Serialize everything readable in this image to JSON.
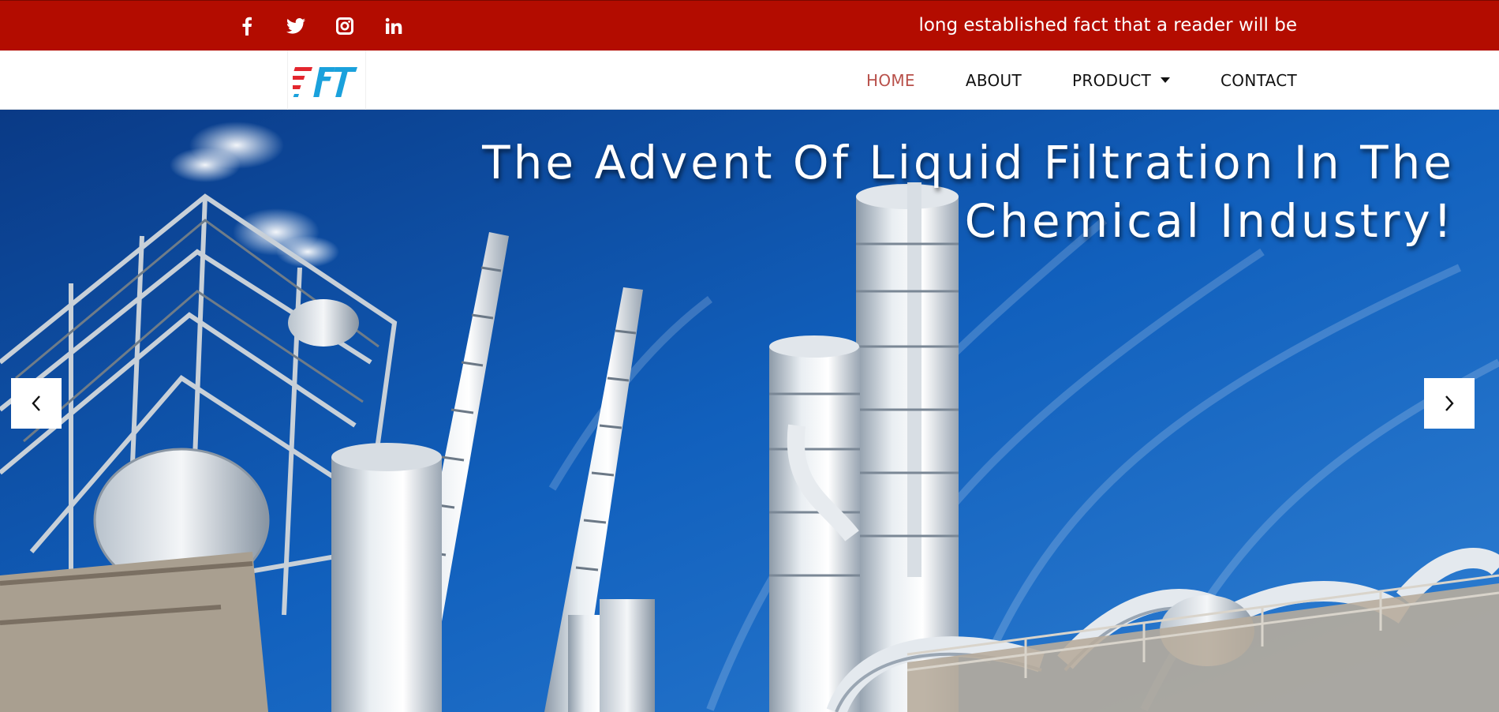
{
  "topbar": {
    "social": [
      {
        "name": "facebook-icon"
      },
      {
        "name": "twitter-icon"
      },
      {
        "name": "instagram-icon"
      },
      {
        "name": "linkedin-icon"
      }
    ],
    "ticker_text": "long established fact that a reader will be",
    "background_color": "#b30c00"
  },
  "logo": {
    "text": "FT"
  },
  "nav": {
    "items": [
      {
        "label": "HOME",
        "active": true
      },
      {
        "label": "ABOUT",
        "active": false
      },
      {
        "label": "PRODUCT",
        "active": false,
        "has_dropdown": true
      },
      {
        "label": "CONTACT",
        "active": false
      }
    ],
    "active_color": "#b8504a"
  },
  "hero": {
    "headline_line1": "The Advent Of Liquid Filtration In The",
    "headline_line2": "Chemical Industry!",
    "prev_icon": "chevron-left-icon",
    "next_icon": "chevron-right-icon"
  }
}
